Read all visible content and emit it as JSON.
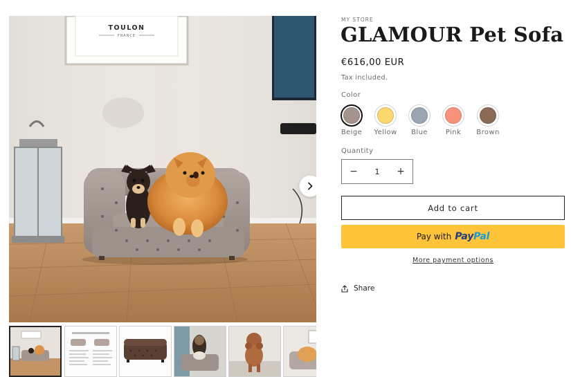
{
  "product": {
    "vendor": "MY STORE",
    "title": "GLAMOUR Pet Sofa",
    "price": "€616,00 EUR",
    "tax_note": "Tax included."
  },
  "gallery": {
    "poster_title": "TOULON",
    "poster_subtitle": "FRANCE",
    "next_icon": "chevron-right-icon",
    "thumbnail_count": 6,
    "active_thumbnail": 1
  },
  "variants": {
    "label": "Color",
    "selected": "Beige",
    "options": [
      {
        "name": "Beige",
        "color": "#a3948d"
      },
      {
        "name": "Yellow",
        "color": "#fcd86f"
      },
      {
        "name": "Blue",
        "color": "#9aa7b3"
      },
      {
        "name": "Pink",
        "color": "#f9927a"
      },
      {
        "name": "Brown",
        "color": "#8c6b54"
      }
    ]
  },
  "quantity": {
    "label": "Quantity",
    "value": "1",
    "minus": "−",
    "plus": "+"
  },
  "actions": {
    "add_to_cart": "Add to cart",
    "paypal_prefix": "Pay with",
    "paypal_brand_1": "Pay",
    "paypal_brand_2": "Pal",
    "more_payment_options": "More payment options",
    "share": "Share"
  },
  "colors": {
    "paypal_yellow": "#ffc439",
    "paypal_dark_blue": "#253b80",
    "paypal_light_blue": "#179bd7"
  }
}
